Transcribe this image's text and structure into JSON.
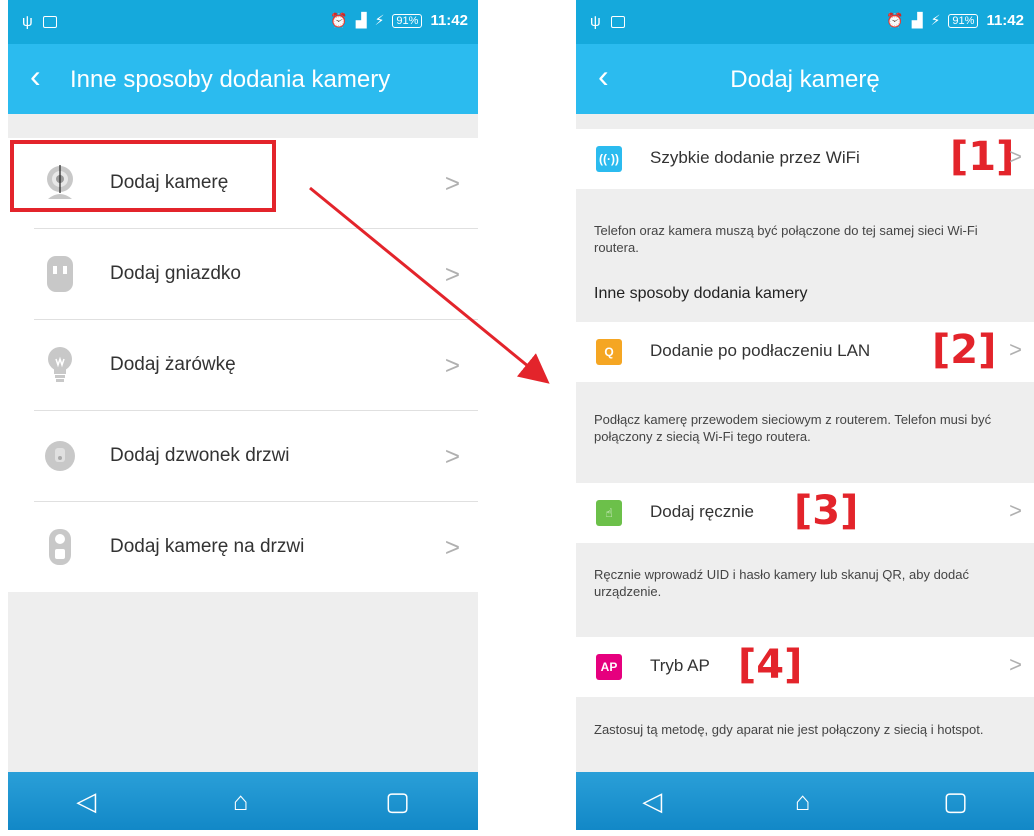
{
  "status_bar": {
    "time": "11:42",
    "battery": "91%",
    "signal": "LTE"
  },
  "left_screen": {
    "title": "Inne sposoby dodania kamery",
    "items": [
      {
        "label": "Dodaj kamerę",
        "icon": "webcam-icon"
      },
      {
        "label": "Dodaj gniazdko",
        "icon": "socket-icon"
      },
      {
        "label": "Dodaj żarówkę",
        "icon": "bulb-icon"
      },
      {
        "label": "Dodaj dzwonek drzwi",
        "icon": "doorbell-icon"
      },
      {
        "label": "Dodaj kamerę na drzwi",
        "icon": "door-camera-icon"
      }
    ]
  },
  "right_screen": {
    "title": "Dodaj kamerę",
    "options": [
      {
        "label": "Szybkie dodanie przez WiFi",
        "tag": "[1]",
        "icon_text": "((·))",
        "icon_color": "#2bbbef",
        "description": "Telefon oraz kamera muszą być połączone do tej samej sieci Wi-Fi routera."
      },
      {
        "label": "Dodanie po podłaczeniu LAN",
        "tag": "[2]",
        "icon_text": "Q",
        "icon_color": "#f5a623",
        "description": "Podłącz kamerę przewodem sieciowym z routerem. Telefon musi być połączony z siecią Wi-Fi tego routera."
      },
      {
        "label": "Dodaj ręcznie",
        "tag": "[3]",
        "icon_text": "☝",
        "icon_color": "#6cc04a",
        "description": "Ręcznie wprowadź UID i hasło kamery lub skanuj QR, aby dodać urządzenie."
      },
      {
        "label": "Tryb AP",
        "tag": "[4]",
        "icon_text": "AP",
        "icon_color": "#e6007e",
        "description": "Zastosuj tą metodę, gdy aparat nie jest połączony z siecią i hotspot."
      }
    ],
    "section_header": "Inne sposoby dodania kamery"
  },
  "colors": {
    "status_bar": "#15a9dc",
    "app_bar": "#2bbbef",
    "highlight": "#e3242b"
  }
}
